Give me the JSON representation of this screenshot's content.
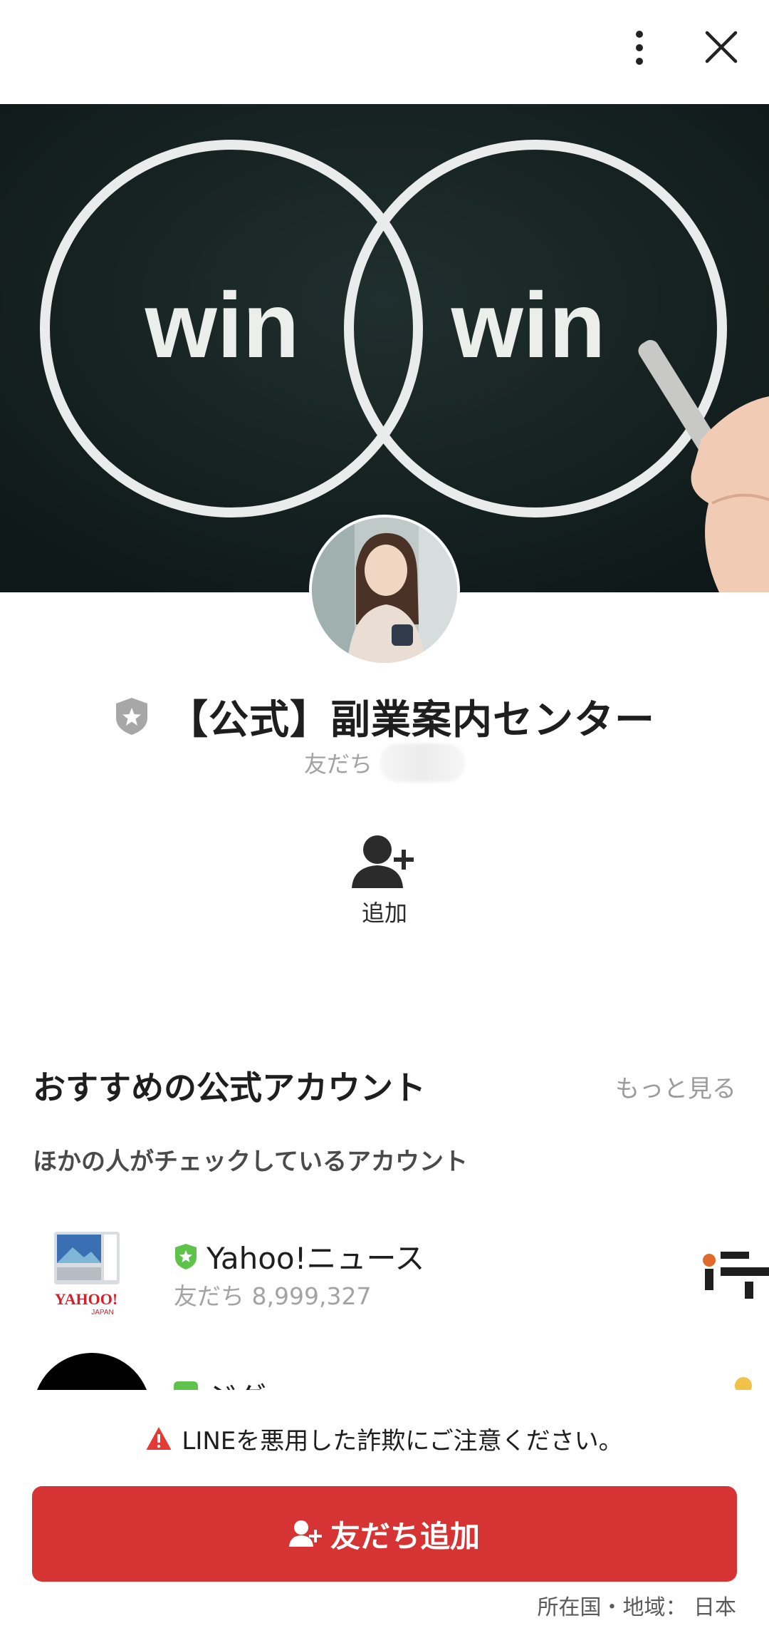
{
  "header": {
    "menu_icon": "more-vertical-icon",
    "close_icon": "close-icon"
  },
  "cover": {
    "left_word": "win",
    "right_word": "win"
  },
  "profile": {
    "name": "【公式】副業案内センター",
    "friends_label": "友だち",
    "verified_icon": "shield-star-icon"
  },
  "actions": {
    "add_label": "追加",
    "add_icon": "add-friend-icon"
  },
  "recommendations": {
    "title": "おすすめの公式アカウント",
    "more_label": "もっと見る",
    "subheading": "ほかの人がチェックしているアカウント",
    "items": [
      {
        "name": "Yahoo!ニュース",
        "friends": "友だち 8,999,327",
        "logo_text": "YAHOO!",
        "logo_sub": "JAPAN"
      },
      {
        "name": "ジグ…"
      }
    ]
  },
  "footer": {
    "warning": "LINEを悪用した詐欺にご注意ください。",
    "cta_label": "友だち追加",
    "region": "所在国・地域： 日本"
  },
  "colors": {
    "cta_red": "#d63434",
    "verified_green": "#5ec24b",
    "shield_gray": "#a7a7a7"
  }
}
